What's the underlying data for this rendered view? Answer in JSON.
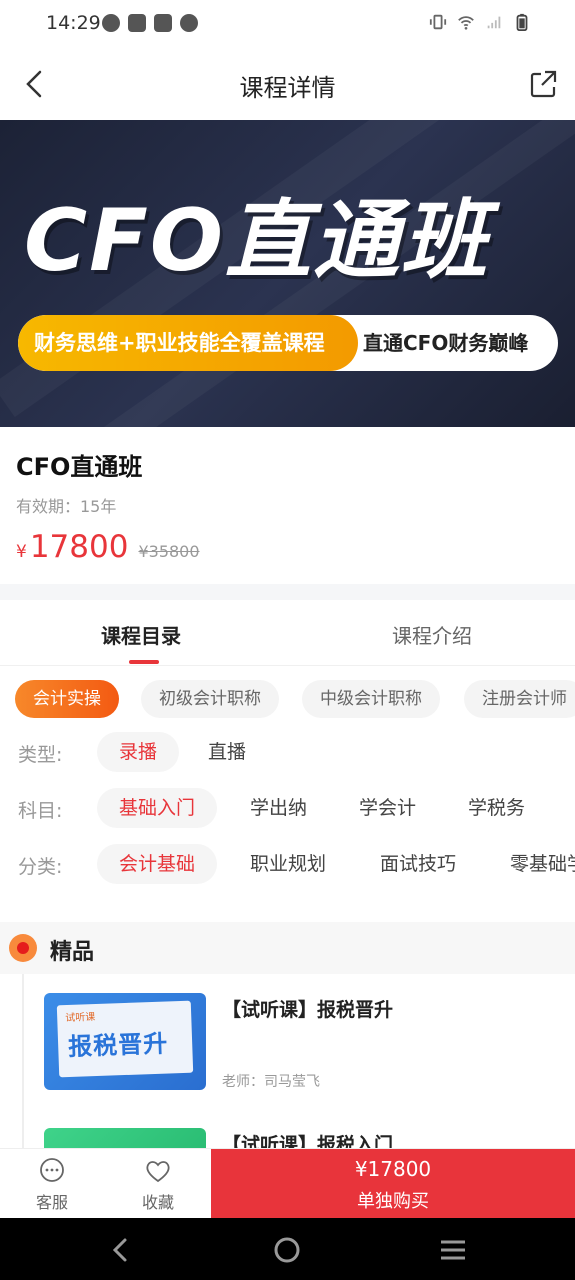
{
  "status_bar": {
    "time": "14:29"
  },
  "nav": {
    "title": "课程详情"
  },
  "banner": {
    "title": "CFO直通班",
    "pill_left": "财务思维+职业技能全覆盖课程",
    "pill_right": "直通CFO财务巅峰"
  },
  "course": {
    "name": "CFO直通班",
    "validity": "有效期：15年",
    "price_symbol": "¥",
    "price": "17800",
    "original_price": "¥35800"
  },
  "tabs": [
    {
      "label": "课程目录",
      "active": true
    },
    {
      "label": "课程介绍",
      "active": false
    }
  ],
  "categories": [
    {
      "label": "会计实操",
      "active": true
    },
    {
      "label": "初级会计职称",
      "active": false
    },
    {
      "label": "中级会计职称",
      "active": false
    },
    {
      "label": "注册会计师",
      "active": false
    }
  ],
  "filters": {
    "type": {
      "label": "类型:",
      "options": [
        "录播",
        "直播"
      ],
      "selected": "录播"
    },
    "subject": {
      "label": "科目:",
      "options": [
        "基础入门",
        "学出纳",
        "学会计",
        "学税务"
      ],
      "selected": "基础入门"
    },
    "classify": {
      "label": "分类:",
      "options": [
        "会计基础",
        "职业规划",
        "面试技巧",
        "零基础学"
      ],
      "selected": "会计基础"
    }
  },
  "section": {
    "title": "精品"
  },
  "course_list": [
    {
      "title": "【试听课】报税晋升",
      "teacher": "老师：司马莹飞",
      "thumb_tag": "试听课",
      "thumb_text": "报税晋升"
    },
    {
      "title": "【试听课】报税入门"
    }
  ],
  "bottom_bar": {
    "service_label": "客服",
    "favorite_label": "收藏",
    "buy_price": "¥17800",
    "buy_label": "单独购买"
  },
  "colors": {
    "accent": "#e8353a",
    "chip_active": "#f35a12"
  }
}
